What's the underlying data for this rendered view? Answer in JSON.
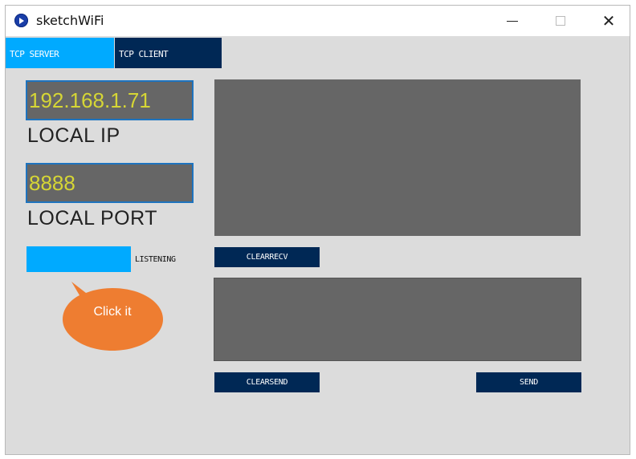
{
  "window": {
    "title": "sketchWiFi"
  },
  "tabs": [
    {
      "label": "TCP SERVER"
    },
    {
      "label": "TCP CLIENT"
    }
  ],
  "left": {
    "ip_value": "192.168.1.71",
    "ip_label": "LOCAL IP",
    "port_value": "8888",
    "port_label": "LOCAL PORT",
    "status_label": "LISTENING"
  },
  "right": {
    "clearrecv_label": "CLEARRECV",
    "clearsend_label": "CLEARSEND",
    "send_label": "SEND"
  },
  "callout": {
    "text": "Click it"
  },
  "colors": {
    "active_tab": "#00aaff",
    "inactive_tab": "#002855",
    "field_bg": "#666666",
    "field_text": "#d6d635",
    "callout": "#ee7d31"
  }
}
